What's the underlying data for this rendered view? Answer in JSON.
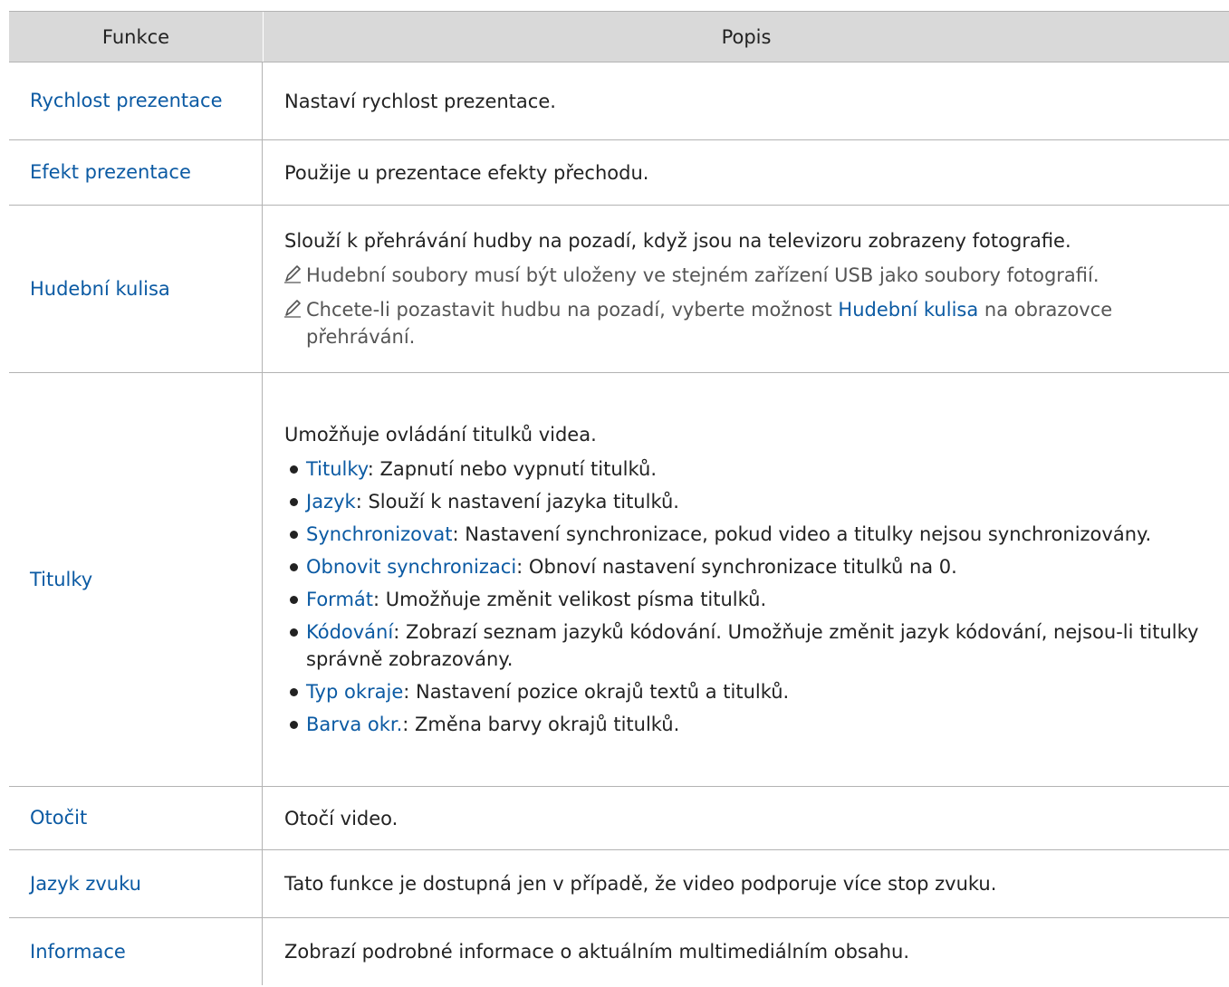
{
  "header": {
    "col1": "Funkce",
    "col2": "Popis"
  },
  "rows": [
    {
      "name": "Rychlost prezentace",
      "desc": "Nastaví rychlost prezentace."
    },
    {
      "name": "Efekt prezentace",
      "desc": "Použije u prezentace efekty přechodu."
    },
    {
      "name": "Hudební kulisa",
      "desc": "Slouží k přehrávání hudby na pozadí, když jsou na televizoru zobrazeny fotografie.",
      "note1": "Hudební soubory musí být uloženy ve stejném zařízení USB jako soubory fotografií.",
      "note2_before": "Chcete-li pozastavit hudbu na pozadí, vyberte možnost ",
      "note2_link": "Hudební kulisa",
      "note2_after": " na obrazovce přehrávání."
    },
    {
      "name": "Titulky",
      "desc": "Umožňuje ovládání titulků videa.",
      "items": [
        {
          "term": "Titulky",
          "text": ": Zapnutí nebo vypnutí titulků."
        },
        {
          "term": "Jazyk",
          "text": ": Slouží k nastavení jazyka titulků."
        },
        {
          "term": "Synchronizovat",
          "text": ": Nastavení synchronizace, pokud video a titulky nejsou synchronizovány."
        },
        {
          "term": "Obnovit synchronizaci",
          "text": ": Obnoví nastavení synchronizace titulků na 0."
        },
        {
          "term": "Formát",
          "text": ": Umožňuje změnit velikost písma titulků."
        },
        {
          "term": "Kódování",
          "text": ": Zobrazí seznam jazyků kódování. Umožňuje změnit jazyk kódování, nejsou-li titulky správně zobrazovány."
        },
        {
          "term": "Typ okraje",
          "text": ": Nastavení pozice okrajů textů a titulků."
        },
        {
          "term": "Barva okr.",
          "text": ": Změna barvy okrajů titulků."
        }
      ]
    },
    {
      "name": "Otočit",
      "desc": "Otočí video."
    },
    {
      "name": "Jazyk zvuku",
      "desc": "Tato funkce je dostupná jen v případě, že video podporuje více stop zvuku."
    },
    {
      "name": "Informace",
      "desc": "Zobrazí podrobné informace o aktuálním multimediálním obsahu."
    }
  ],
  "icons": {
    "note": "pencil-icon"
  },
  "colors": {
    "link": "#0b5aa3",
    "header_bg": "#d9d9d9",
    "border": "#b3b3b3"
  }
}
